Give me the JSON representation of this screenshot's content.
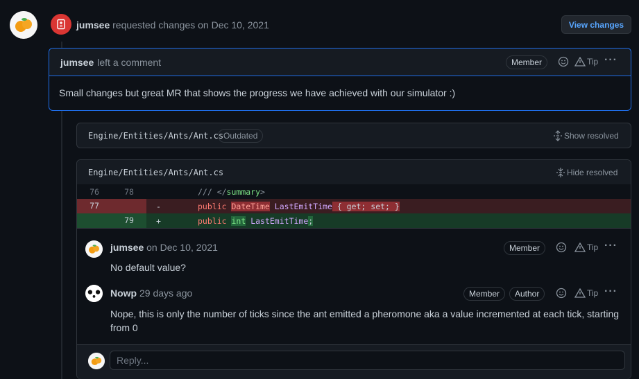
{
  "event": {
    "actor": "jumsee",
    "action": "requested changes on",
    "date": "Dec 10, 2021",
    "view_changes_label": "View changes"
  },
  "review_comment": {
    "author": "jumsee",
    "action": "left a comment",
    "badge": "Member",
    "tip_label": "Tip",
    "body": "Small changes but great MR that shows the progress we have achieved with our simulator :)"
  },
  "outdated_file": {
    "path": "Engine/Entities/Ants/Ant.cs",
    "badge": "Outdated",
    "toggle_label": "Show resolved"
  },
  "file": {
    "path": "Engine/Entities/Ants/Ant.cs",
    "toggle_label": "Hide resolved",
    "diff": [
      {
        "old": "76",
        "new": "78",
        "sign": "",
        "code": "/// </summary>"
      },
      {
        "old": "77",
        "new": "",
        "sign": "-",
        "code": "public DateTime LastEmitTime { get; set; }"
      },
      {
        "old": "",
        "new": "79",
        "sign": "+",
        "code": "public int LastEmitTime;"
      }
    ]
  },
  "thread": [
    {
      "author": "jumsee",
      "meta": "on Dec 10, 2021",
      "badges": [
        "Member"
      ],
      "tip_label": "Tip",
      "body": "No default value?"
    },
    {
      "author": "Nowp",
      "meta": "29 days ago",
      "badges": [
        "Member",
        "Author"
      ],
      "tip_label": "Tip",
      "body": "Nope, this is only the number of ticks since the ant emitted a pheromone aka a value incremented at each tick, starting from 0"
    }
  ],
  "reply": {
    "placeholder": "Reply..."
  },
  "colors": {
    "background": "#0d1117",
    "accent": "#58a6ff",
    "request_changes": "#da3633",
    "deletion_bg": "#4c1d22",
    "addition_bg": "#1a3a26"
  }
}
